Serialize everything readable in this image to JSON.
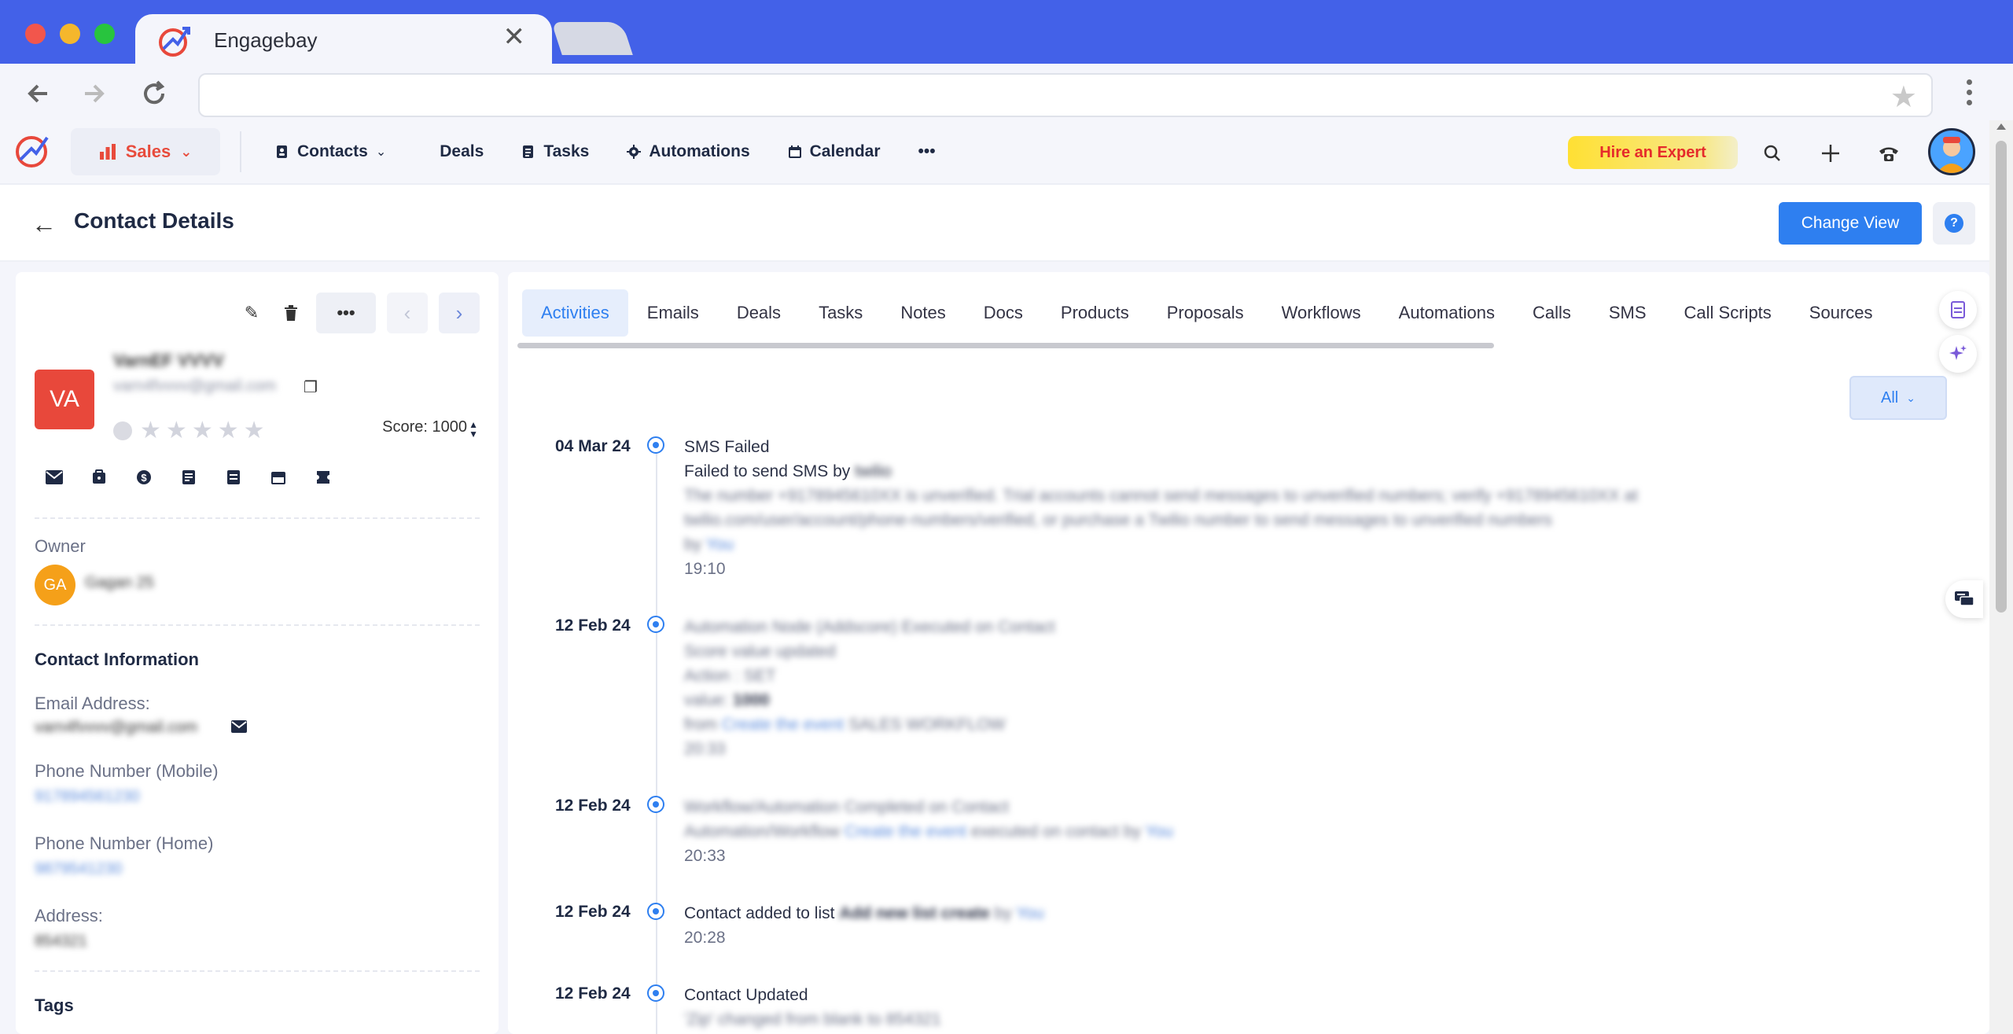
{
  "browser": {
    "tab_title": "Engagebay",
    "tab_close": "✕"
  },
  "appnav": {
    "sales_label": "Sales",
    "items": [
      {
        "label": "Contacts",
        "icon": "contact-book-icon",
        "dropdown": true
      },
      {
        "label": "Deals",
        "icon": "",
        "dropdown": false
      },
      {
        "label": "Tasks",
        "icon": "tasks-icon",
        "dropdown": false
      },
      {
        "label": "Automations",
        "icon": "gear-icon",
        "dropdown": false
      },
      {
        "label": "Calendar",
        "icon": "calendar-icon",
        "dropdown": false
      }
    ],
    "more_label": "•••",
    "hire_label": "Hire an Expert"
  },
  "page": {
    "title": "Contact Details",
    "change_view_label": "Change View",
    "help_label": "?"
  },
  "contact": {
    "initials": "VA",
    "name": "VarnEF VVVV",
    "email": "varn4fvvvv@gmail.com",
    "score_label": "Score: 1000",
    "more_label": "•••",
    "owner_label": "Owner",
    "owner_initials": "GA",
    "owner_name": "Gagan 25",
    "section_contact_info": "Contact Information",
    "email_label": "Email Address:",
    "email_value": "varn4fvvvv@gmail.com",
    "mobile_label": "Phone Number (Mobile)",
    "mobile_value": "917894561230",
    "home_label": "Phone Number (Home)",
    "home_value": "9879541230",
    "address_label": "Address:",
    "address_value": "854321",
    "tags_label": "Tags"
  },
  "tabs": [
    "Activities",
    "Emails",
    "Deals",
    "Tasks",
    "Notes",
    "Docs",
    "Products",
    "Proposals",
    "Workflows",
    "Automations",
    "Calls",
    "SMS",
    "Call Scripts",
    "Sources"
  ],
  "filter": {
    "label": "All"
  },
  "activities": [
    {
      "date": "04 Mar 24",
      "title": "SMS Failed",
      "line2": "Failed to send SMS by",
      "line2_blur": "twilio",
      "line3": "The number +9178945610XX is unverified. Trial accounts cannot send messages to unverified numbers; verify +9178945610XX at",
      "line4": "twilio.com/user/account/phone-numbers/verified, or purchase a Twilio number to send messages to unverified numbers",
      "by_prefix": "by",
      "by_link": "You",
      "time": "19:10"
    },
    {
      "date": "12 Feb 24",
      "title": "Automation Node (Addscore) Executed on Contact",
      "line2": "Score value updated",
      "line3": "Action : SET",
      "line4_prefix": "value:",
      "line4_value": "1000",
      "from_prefix": "from",
      "from_link": "Create the event",
      "from_suffix": "SALES WORKFLOW",
      "time": "20:33"
    },
    {
      "date": "12 Feb 24",
      "title": "Workflow/Automation Completed on Contact",
      "line2_prefix": "Automation/Workflow",
      "line2_link": "Create the event",
      "line2_mid": "executed on contact by",
      "line2_by": "You",
      "time": "20:33"
    },
    {
      "date": "12 Feb 24",
      "title": "Contact added to list",
      "list_name": "Add new list create",
      "by_prefix": "by",
      "by_link": "You",
      "time": "20:28"
    },
    {
      "date": "12 Feb 24",
      "title": "Contact Updated",
      "line2": "'Zip' changed from blank to 854321"
    }
  ]
}
